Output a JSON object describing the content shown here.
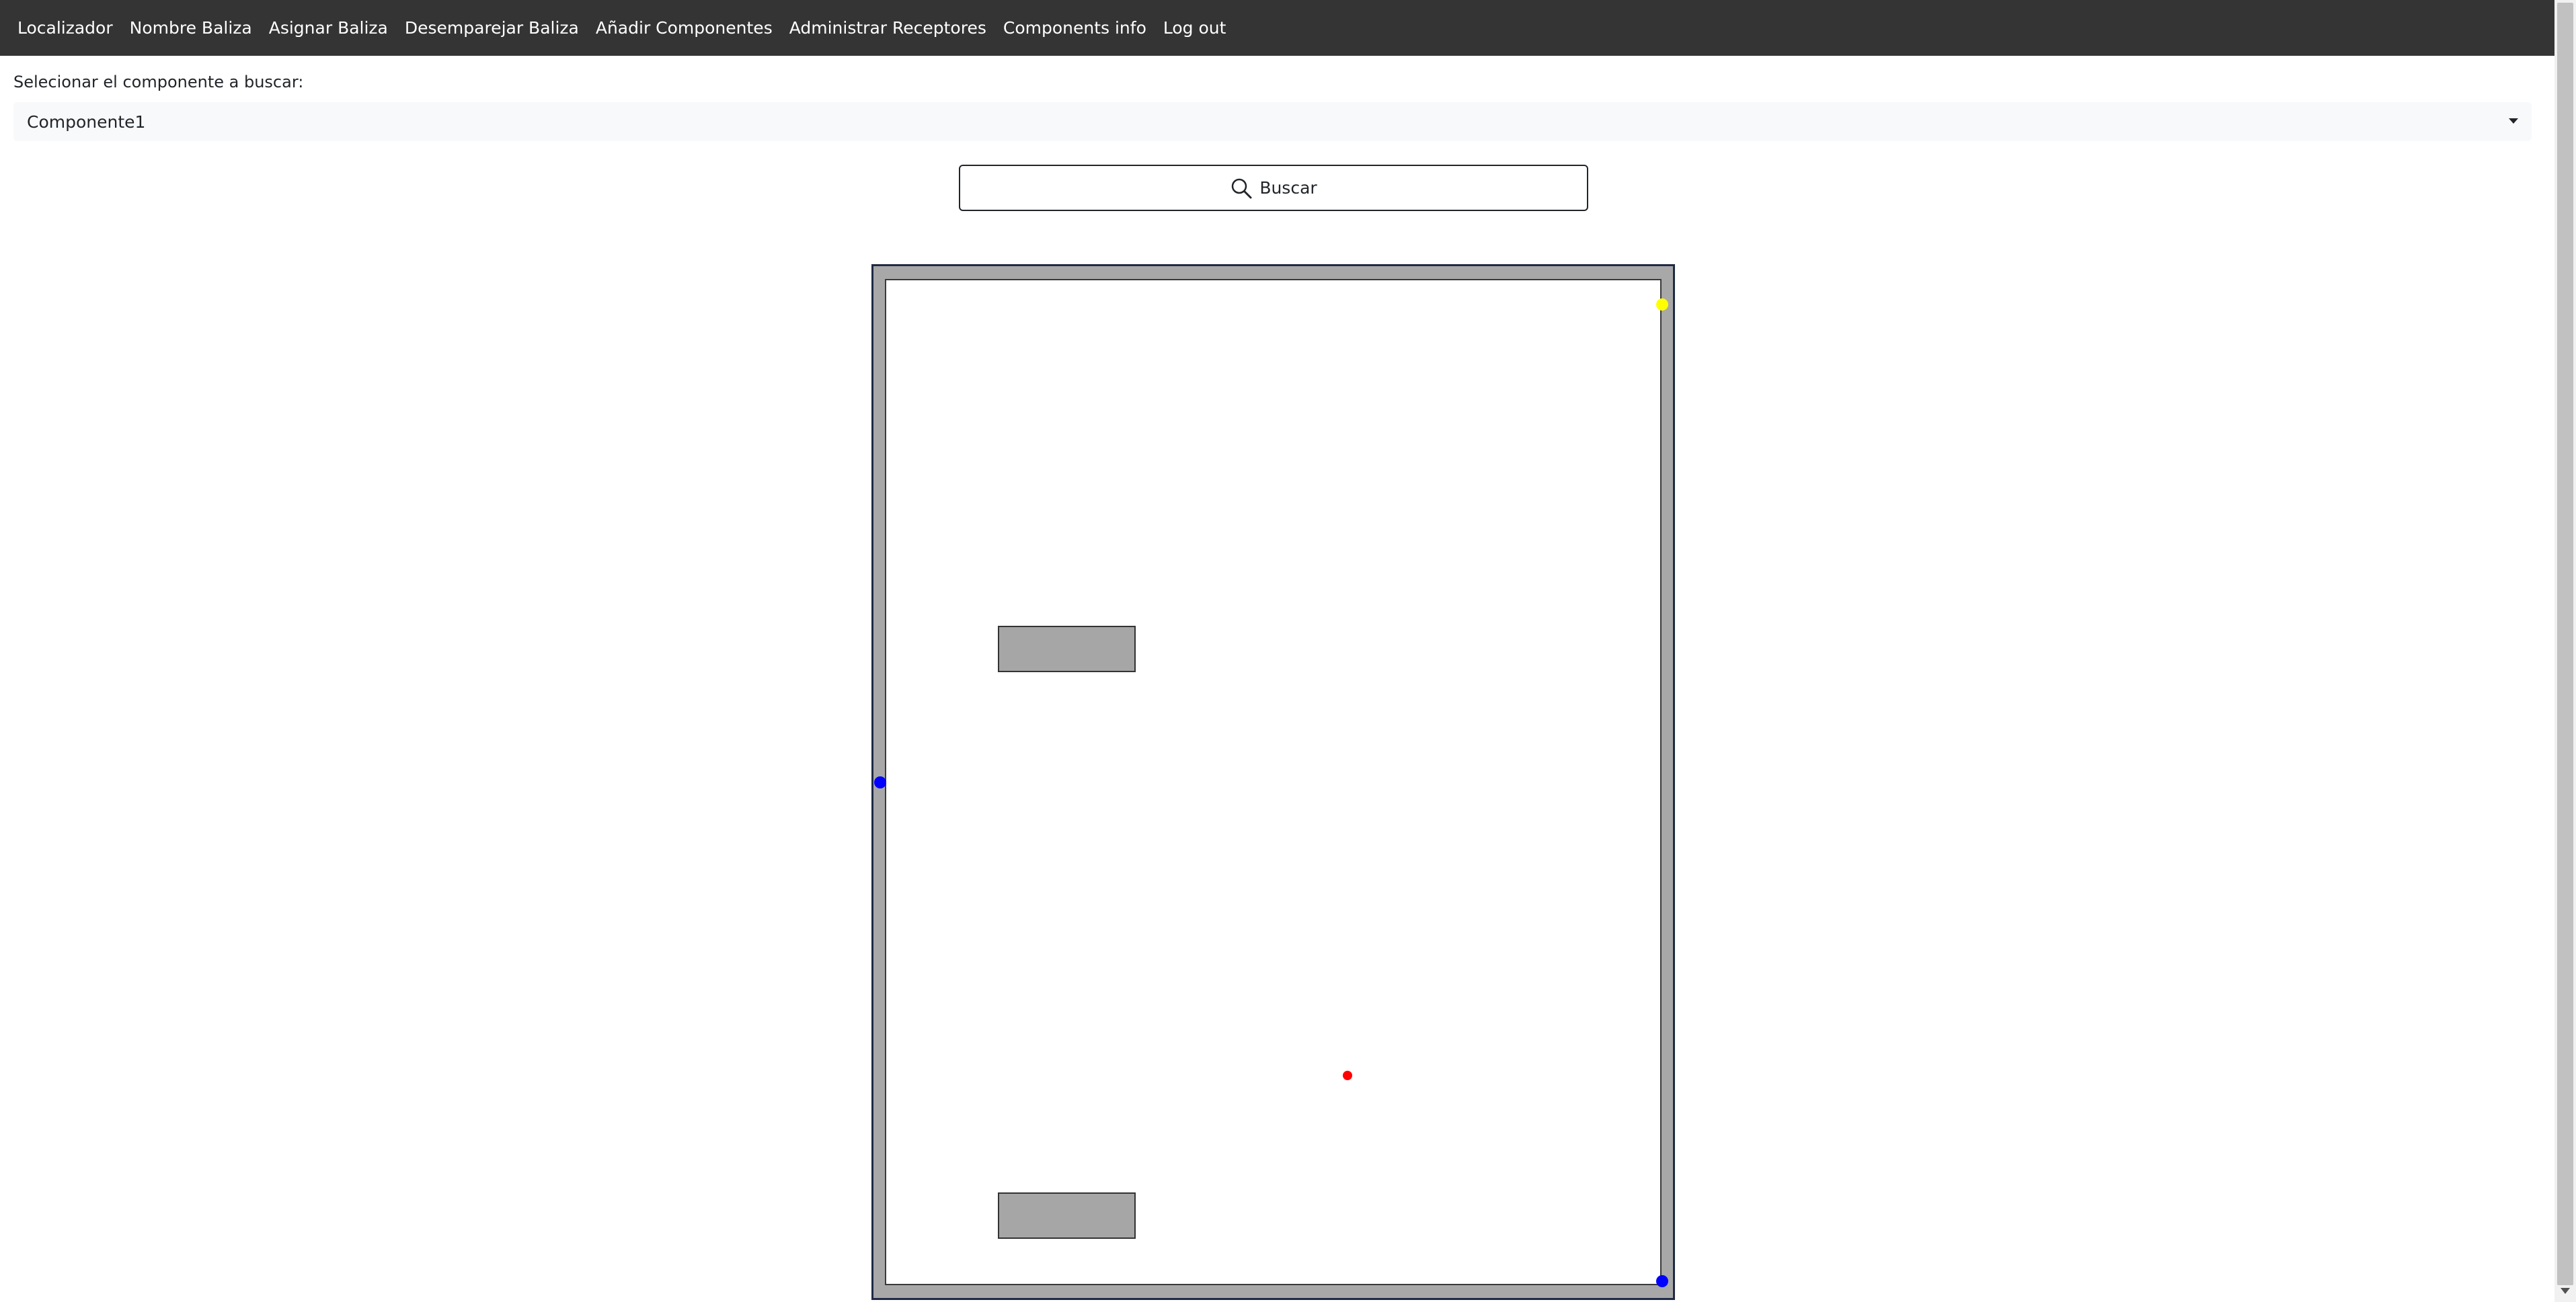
{
  "nav": {
    "items": [
      {
        "label": "Localizador"
      },
      {
        "label": "Nombre Baliza"
      },
      {
        "label": "Asignar Baliza"
      },
      {
        "label": "Desemparejar Baliza"
      },
      {
        "label": "Añadir Componentes"
      },
      {
        "label": "Administrar Receptores"
      },
      {
        "label": "Components info"
      },
      {
        "label": "Log out"
      }
    ]
  },
  "search": {
    "label": "Selecionar el componente a buscar:",
    "selected_component": "Componente1",
    "button_label": "Buscar",
    "button_icon": "search-icon"
  },
  "map": {
    "colors": {
      "wall": "#a8a8a8",
      "floor": "#ffffff",
      "obstacle": "#a6a6a6",
      "receptor_blue": "#0000ff",
      "receptor_yellow": "#ffff00",
      "located_component": "#ff0000"
    }
  }
}
